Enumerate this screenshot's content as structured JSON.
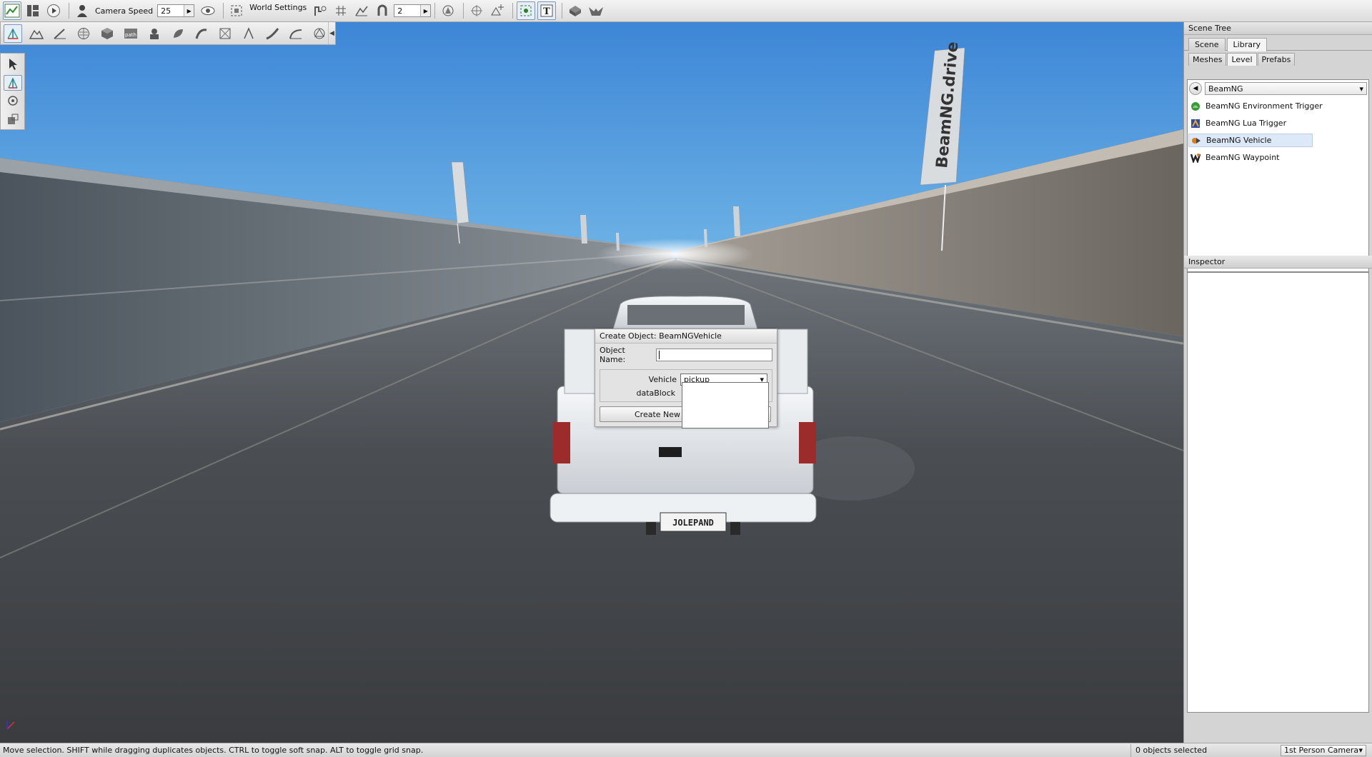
{
  "toolbar": {
    "camera_speed_label": "Camera Speed",
    "camera_speed_value": "25",
    "world_settings_label": "World Settings",
    "grid_value": "2"
  },
  "scene_tree": {
    "title": "Scene Tree",
    "tabs": [
      "Scene",
      "Library"
    ],
    "active_tab": "Library",
    "subtabs": [
      "Meshes",
      "Level",
      "Prefabs"
    ],
    "active_subtab": "Level",
    "path": "BeamNG",
    "items": [
      {
        "label": "BeamNG Environment Trigger",
        "icon": "environment-trigger-icon",
        "color": "#3a9a3a"
      },
      {
        "label": "BeamNG Lua Trigger",
        "icon": "lua-trigger-icon",
        "color": "#2a4fa0"
      },
      {
        "label": "BeamNG Vehicle",
        "icon": "vehicle-icon",
        "color": "#e07a1a"
      },
      {
        "label": "BeamNG Waypoint",
        "icon": "waypoint-icon",
        "color": "#222222"
      }
    ],
    "selected_item": "BeamNG Vehicle"
  },
  "inspector": {
    "title": "Inspector"
  },
  "dialog": {
    "title": "Create Object: BeamNGVehicle",
    "object_name_label": "Object Name:",
    "object_name_value": "",
    "vehicle_label": "Vehicle",
    "vehicle_value": "pickup",
    "datablock_label": "dataBlock",
    "create_button": "Create New"
  },
  "viewport": {
    "banner_text": "BeamNG.drive",
    "license_plate": "JOLEPAND",
    "brand_color": "#e8701e"
  },
  "status_bar": {
    "message": "Move selection.  SHIFT while dragging duplicates objects.  CTRL to toggle soft snap.  ALT to toggle grid snap.",
    "selection": "0 objects selected",
    "camera_mode": "1st Person Camera"
  }
}
